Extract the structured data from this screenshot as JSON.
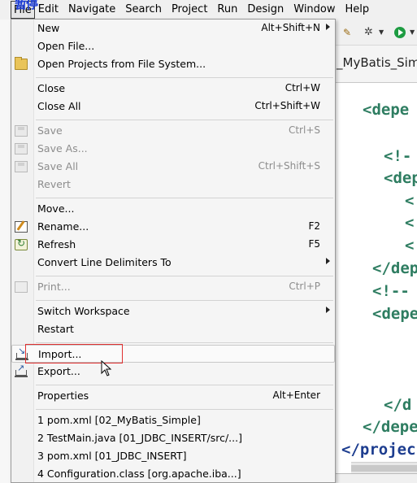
{
  "menubar": {
    "items": [
      "File",
      "Edit",
      "Navigate",
      "Search",
      "Project",
      "Run",
      "Design",
      "Window",
      "Help"
    ]
  },
  "top_overlay_text": "暂停",
  "editor": {
    "tab_title": "_MyBatis_Simp",
    "code_lines": [
      "<depe",
      "<!-",
      "<dep",
      "<",
      "<",
      "<",
      "</dep",
      "<!--",
      "<depe",
      "</d",
      "</depe",
      "</projec"
    ]
  },
  "file_menu": {
    "new": {
      "label": "New",
      "shortcut": "Alt+Shift+N"
    },
    "open_file": {
      "label": "Open File..."
    },
    "open_projects": {
      "label": "Open Projects from File System..."
    },
    "close": {
      "label": "Close",
      "shortcut": "Ctrl+W"
    },
    "close_all": {
      "label": "Close All",
      "shortcut": "Ctrl+Shift+W"
    },
    "save": {
      "label": "Save",
      "shortcut": "Ctrl+S"
    },
    "save_as": {
      "label": "Save As..."
    },
    "save_all": {
      "label": "Save All",
      "shortcut": "Ctrl+Shift+S"
    },
    "revert": {
      "label": "Revert"
    },
    "move": {
      "label": "Move..."
    },
    "rename": {
      "label": "Rename...",
      "shortcut": "F2"
    },
    "refresh": {
      "label": "Refresh",
      "shortcut": "F5"
    },
    "convert": {
      "label": "Convert Line Delimiters To"
    },
    "print": {
      "label": "Print...",
      "shortcut": "Ctrl+P"
    },
    "switch_workspace": {
      "label": "Switch Workspace"
    },
    "restart": {
      "label": "Restart"
    },
    "import": {
      "label": "Import..."
    },
    "export": {
      "label": "Export..."
    },
    "properties": {
      "label": "Properties",
      "shortcut": "Alt+Enter"
    },
    "recent": [
      "1 pom.xml  [02_MyBatis_Simple]",
      "2 TestMain.java  [01_JDBC_INSERT/src/...]",
      "3 pom.xml  [01_JDBC_INSERT]",
      "4 Configuration.class  [org.apache.iba...]"
    ]
  },
  "colors": {
    "highlight_box": "#e03030",
    "code_green": "#2e7d61",
    "code_blue": "#1d3d8f"
  }
}
